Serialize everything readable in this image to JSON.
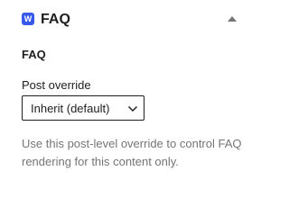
{
  "colors": {
    "accent": "#3858e9",
    "text": "#1e1e1e",
    "muted": "#757575"
  },
  "panel": {
    "icon": "plugin-logo-icon",
    "icon_glyph": "W",
    "title": "FAQ",
    "toggle_icon": "caret-up-icon"
  },
  "section": {
    "heading": "FAQ"
  },
  "post_override": {
    "label": "Post override",
    "selected": "Inherit (default)",
    "dropdown_icon": "chevron-down-icon"
  },
  "help_text": "Use this post-level override to control FAQ rendering for this content only."
}
